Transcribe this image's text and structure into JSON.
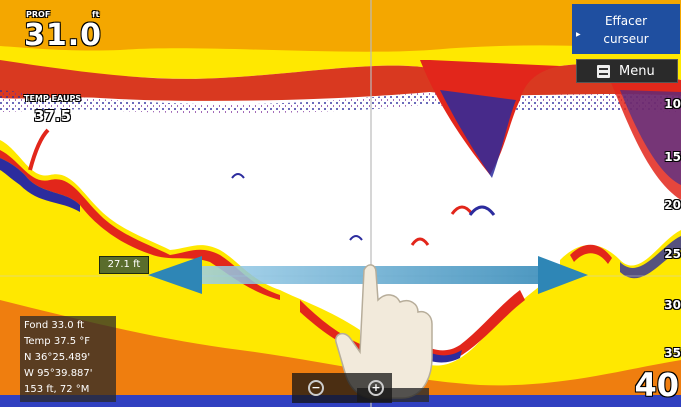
{
  "depth": {
    "label": "PROF",
    "unit": "ft",
    "value": "31.0"
  },
  "water_temp": {
    "label": "TEMP EAUPS",
    "value": "37.5"
  },
  "buttons": {
    "clear_cursor": "Effacer curseur",
    "menu": "Menu"
  },
  "depth_scale": [
    "10",
    "15",
    "20",
    "25",
    "30",
    "35"
  ],
  "range": "40",
  "cursor_distance": "27.1 ft",
  "info_panel": [
    "Fond  33.0  ft",
    "Temp  37.5 °F",
    "N  36°25.489'",
    "W 95°39.887'",
    "153 ft, 72 °M"
  ],
  "colors": {
    "sonar_background": "#ffffff",
    "bottom_yellow": "#ffe800",
    "bottom_red": "#e2261b",
    "fish_blue": "#2c2c9e",
    "arrow_blue": "#2e86b6",
    "button_blue": "#1f4fa0"
  }
}
